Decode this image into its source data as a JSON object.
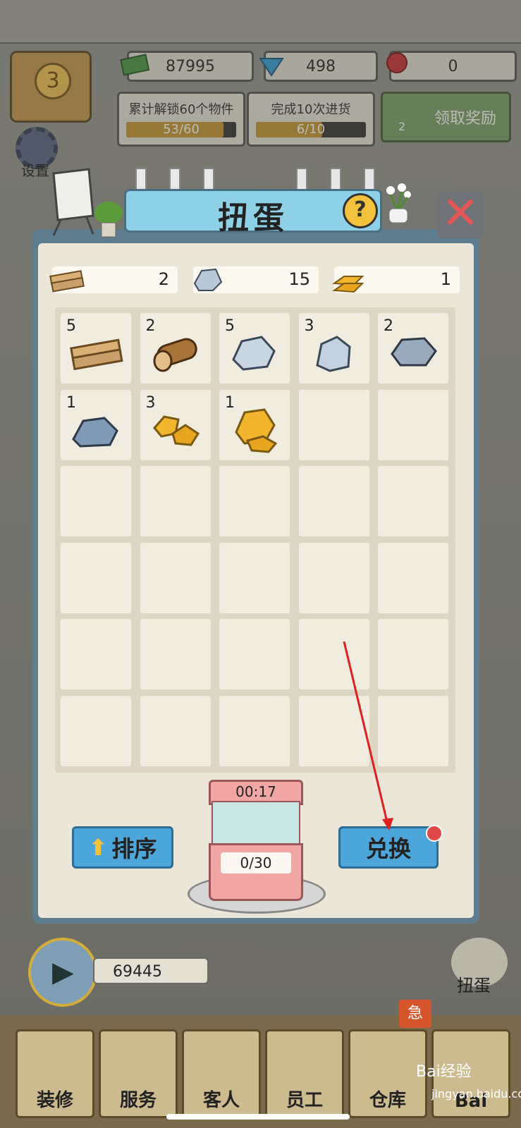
{
  "top": {
    "level": "3",
    "money": "87995",
    "gems": "498",
    "roses": "0"
  },
  "tasks": [
    {
      "label": "累计解锁60个物件",
      "progress": "53/60",
      "ratio": 0.883
    },
    {
      "label": "完成10次进货",
      "progress": "6/10",
      "ratio": 0.6
    }
  ],
  "claim": {
    "label": "领取奖励",
    "badge": "2"
  },
  "side": {
    "settings": "设置"
  },
  "modal": {
    "title": "扭蛋",
    "materials": [
      {
        "name": "wood-plank",
        "value": "2"
      },
      {
        "name": "stone",
        "value": "15"
      },
      {
        "name": "gold-bar",
        "value": "1"
      }
    ],
    "items": [
      {
        "count": "5",
        "icon": "plank-icon"
      },
      {
        "count": "2",
        "icon": "log-icon"
      },
      {
        "count": "5",
        "icon": "silver-stone-icon"
      },
      {
        "count": "3",
        "icon": "silver-rocks-icon"
      },
      {
        "count": "2",
        "icon": "gray-stone-icon"
      },
      {
        "count": "1",
        "icon": "blue-stone-icon"
      },
      {
        "count": "3",
        "icon": "gold-nuggets-icon"
      },
      {
        "count": "1",
        "icon": "gold-ore-icon"
      }
    ],
    "sort_label": "排序",
    "exchange_label": "兑换",
    "machine_timer": "00:17",
    "machine_count": "0/30"
  },
  "bottom": {
    "cash": "69445",
    "gacha_label": "扭蛋",
    "urgent": "急",
    "nav": [
      "装修",
      "服务",
      "客人",
      "员工",
      "仓库",
      "Bai"
    ]
  },
  "watermark": {
    "brand": "Bai经验",
    "url": "jingyan.baidu.com"
  },
  "colors": {
    "accent_blue": "#4da6da",
    "notice_red": "#e04848"
  }
}
